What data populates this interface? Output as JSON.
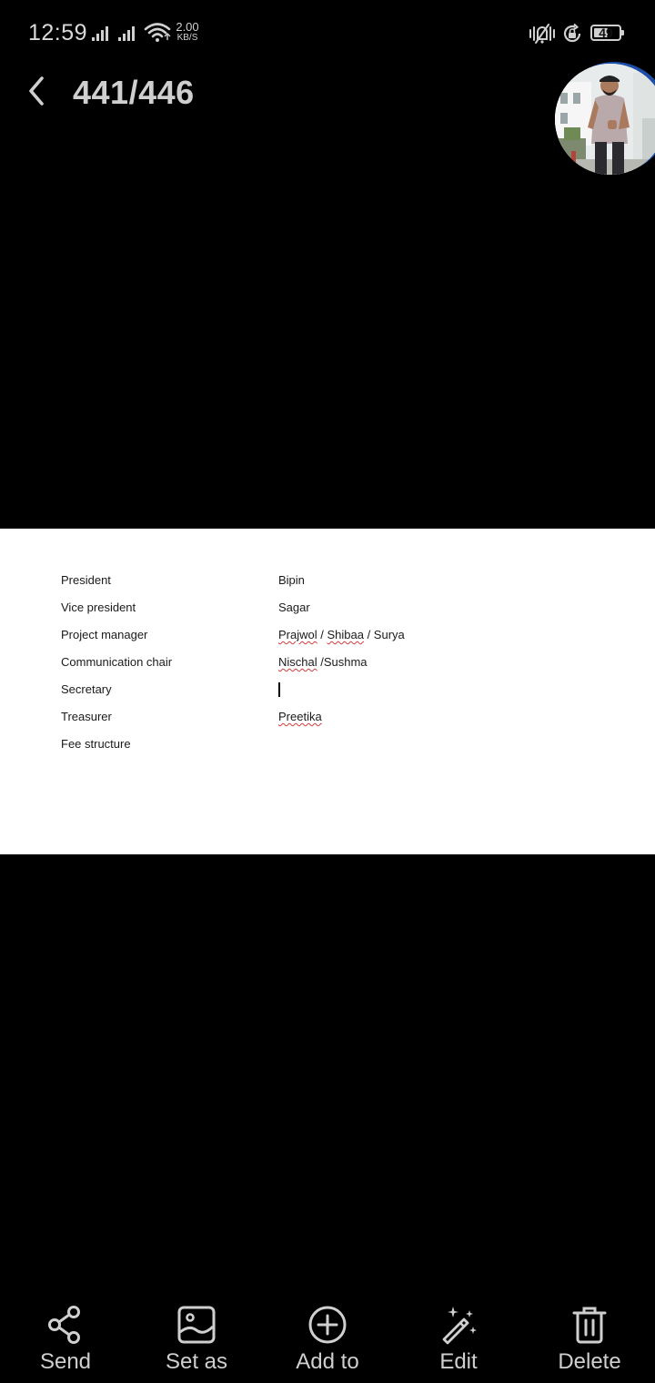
{
  "status_bar": {
    "time": "12:59",
    "net_speed_value": "2.00",
    "net_speed_unit": "KB/S",
    "battery_level": "49",
    "battery_fraction": 0.49
  },
  "header": {
    "counter": "441/446"
  },
  "document": {
    "rows": [
      {
        "label": "President",
        "value": "Bipin"
      },
      {
        "label": "Vice president",
        "value": "Sagar"
      },
      {
        "label": "Project manager",
        "value": "Prajwol / Shibaa / Surya"
      },
      {
        "label": "Communication chair",
        "value": "Nischal /Sushma"
      },
      {
        "label": "Secretary",
        "value": ""
      },
      {
        "label": "Treasurer",
        "value": "Preetika"
      },
      {
        "label": "Fee structure",
        "value": ""
      }
    ]
  },
  "toolbar": {
    "send": "Send",
    "set_as": "Set as",
    "add_to": "Add to",
    "edit": "Edit",
    "delete": "Delete"
  }
}
